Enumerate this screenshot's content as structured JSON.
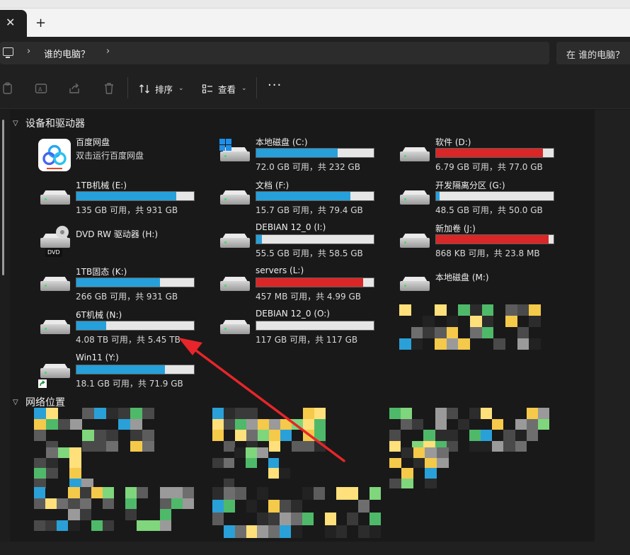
{
  "window": {
    "tab_close_glyph": "✕",
    "new_tab_glyph": "+"
  },
  "address": {
    "breadcrumb": "谁的电脑？",
    "search_placeholder": "在 谁的电脑？"
  },
  "toolbar": {
    "sort_label": "排序",
    "view_label": "查看",
    "more_glyph": "···"
  },
  "sections": {
    "devices_title": "设备和驱动器",
    "network_title": "网络位置"
  },
  "colors": {
    "bar_normal": "#26a0da",
    "bar_full": "#da2626",
    "arrow": "#e8252a"
  },
  "drives": [
    {
      "name": "百度网盘",
      "info": "双击运行百度网盘",
      "icon": "baidu-netdisk-icon",
      "fraction": null
    },
    {
      "name": "本地磁盘 (C:)",
      "info": "72.0 GB 可用，共 232 GB",
      "icon": "windows-drive-icon",
      "fraction": 0.69,
      "full": false
    },
    {
      "name": "软件 (D:)",
      "info": "6.79 GB 可用，共 77.0 GB",
      "icon": "hard-drive-icon",
      "fraction": 0.91,
      "full": true
    },
    {
      "name": "1TB机械 (E:)",
      "info": "135 GB 可用，共 931 GB",
      "icon": "hard-drive-icon",
      "fraction": 0.85,
      "full": false
    },
    {
      "name": "文档 (F:)",
      "info": "15.7 GB 可用，共 79.4 GB",
      "icon": "hard-drive-icon",
      "fraction": 0.8,
      "full": false
    },
    {
      "name": "开发隔离分区 (G:)",
      "info": "48.5 GB 可用，共 50.0 GB",
      "icon": "hard-drive-icon",
      "fraction": 0.03,
      "full": false
    },
    {
      "name": "DVD RW 驱动器 (H:)",
      "info": "",
      "icon": "dvd-drive-icon",
      "fraction": null
    },
    {
      "name": "DEBIAN 12_0 (I:)",
      "info": "55.5 GB 可用，共 58.5 GB",
      "icon": "hard-drive-icon",
      "fraction": 0.05,
      "full": false
    },
    {
      "name": "新加卷 (J:)",
      "info": "868 KB 可用，共 23.8 MB",
      "icon": "hard-drive-icon",
      "fraction": 0.96,
      "full": true
    },
    {
      "name": "1TB固态 (K:)",
      "info": "266 GB 可用，共 931 GB",
      "icon": "hard-drive-icon",
      "fraction": 0.71,
      "full": false
    },
    {
      "name": "servers (L:)",
      "info": "457 MB 可用，共 4.99 GB",
      "icon": "hard-drive-icon",
      "fraction": 0.91,
      "full": true
    },
    {
      "name": "本地磁盘 (M:)",
      "info": "",
      "icon": "hard-drive-icon",
      "fraction": null
    },
    {
      "name": "6T机械 (N:)",
      "info": "4.08 TB 可用，共 5.45 TB",
      "icon": "hard-drive-icon",
      "fraction": 0.25,
      "full": false
    },
    {
      "name": "DEBIAN 12_0 (O:)",
      "info": "117 GB 可用，共 117 GB",
      "icon": "hard-drive-icon",
      "fraction": 0.0,
      "full": false
    },
    {
      "name": "Win11 (Y:)",
      "info": "18.1 GB 可用，共 71.9 GB",
      "icon": "shortcut-drive-icon",
      "fraction": 0.75,
      "full": false
    }
  ],
  "dvd_label": "DVD"
}
